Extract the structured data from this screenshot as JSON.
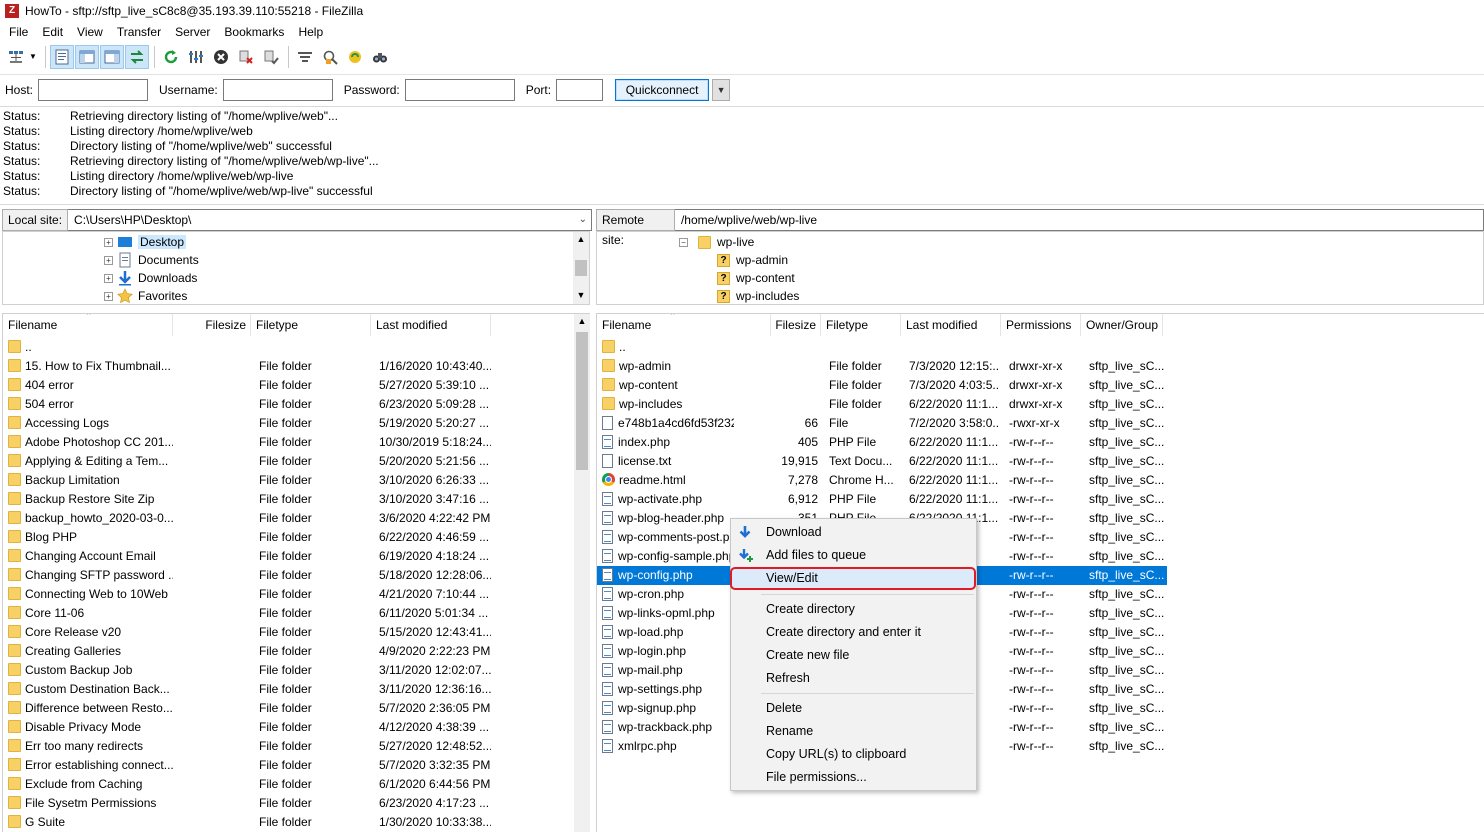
{
  "window": {
    "title": "HowTo - sftp://sftp_live_sC8c8@35.193.39.110:55218 - FileZilla",
    "app_icon": "filezilla-icon"
  },
  "menu": [
    "File",
    "Edit",
    "View",
    "Transfer",
    "Server",
    "Bookmarks",
    "Help"
  ],
  "toolbar": {
    "icons": [
      "site-manager-icon",
      "toggle-message-log-icon",
      "toggle-local-tree-icon",
      "toggle-remote-tree-icon",
      "toggle-transfer-queue-icon",
      "refresh-icon",
      "process-queue-icon",
      "cancel-icon",
      "disconnect-icon",
      "reconnect-icon",
      "directory-filter-icon",
      "compare-icon",
      "sync-browse-icon",
      "search-icon"
    ]
  },
  "quickconnect": {
    "host_label": "Host:",
    "host_value": "",
    "username_label": "Username:",
    "username_value": "",
    "password_label": "Password:",
    "password_value": "",
    "port_label": "Port:",
    "port_value": "",
    "button_label": "Quickconnect"
  },
  "log": [
    {
      "label": "Status:",
      "text": "Retrieving directory listing of \"/home/wplive/web\"..."
    },
    {
      "label": "Status:",
      "text": "Listing directory /home/wplive/web"
    },
    {
      "label": "Status:",
      "text": "Directory listing of \"/home/wplive/web\" successful"
    },
    {
      "label": "Status:",
      "text": "Retrieving directory listing of \"/home/wplive/web/wp-live\"..."
    },
    {
      "label": "Status:",
      "text": "Listing directory /home/wplive/web/wp-live"
    },
    {
      "label": "Status:",
      "text": "Directory listing of \"/home/wplive/web/wp-live\" successful"
    }
  ],
  "local": {
    "site_label": "Local site:",
    "path": "C:\\Users\\HP\\Desktop\\",
    "tree": [
      "Desktop",
      "Documents",
      "Downloads",
      "Favorites"
    ],
    "headers": [
      "Filename",
      "Filesize",
      "Filetype",
      "Last modified"
    ],
    "rows": [
      {
        "name": "..",
        "type": "",
        "modified": ""
      },
      {
        "name": "15. How to Fix Thumbnail...",
        "type": "File folder",
        "modified": "1/16/2020 10:43:40..."
      },
      {
        "name": "404 error",
        "type": "File folder",
        "modified": "5/27/2020 5:39:10 ..."
      },
      {
        "name": "504 error",
        "type": "File folder",
        "modified": "6/23/2020 5:09:28 ..."
      },
      {
        "name": "Accessing Logs",
        "type": "File folder",
        "modified": "5/19/2020 5:20:27 ..."
      },
      {
        "name": "Adobe Photoshop CC 201...",
        "type": "File folder",
        "modified": "10/30/2019 5:18:24..."
      },
      {
        "name": "Applying & Editing a Tem...",
        "type": "File folder",
        "modified": "5/20/2020 5:21:56 ..."
      },
      {
        "name": "Backup Limitation",
        "type": "File folder",
        "modified": "3/10/2020 6:26:33 ..."
      },
      {
        "name": "Backup Restore Site Zip",
        "type": "File folder",
        "modified": "3/10/2020 3:47:16 ..."
      },
      {
        "name": "backup_howto_2020-03-0...",
        "type": "File folder",
        "modified": "3/6/2020 4:22:42 PM"
      },
      {
        "name": "Blog PHP",
        "type": "File folder",
        "modified": "6/22/2020 4:46:59 ..."
      },
      {
        "name": "Changing Account Email",
        "type": "File folder",
        "modified": "6/19/2020 4:18:24 ..."
      },
      {
        "name": "Changing SFTP password ...",
        "type": "File folder",
        "modified": "5/18/2020 12:28:06..."
      },
      {
        "name": "Connecting Web to 10Web",
        "type": "File folder",
        "modified": "4/21/2020 7:10:44 ..."
      },
      {
        "name": "Core 11-06",
        "type": "File folder",
        "modified": "6/11/2020 5:01:34 ..."
      },
      {
        "name": "Core Release v20",
        "type": "File folder",
        "modified": "5/15/2020 12:43:41..."
      },
      {
        "name": "Creating Galleries",
        "type": "File folder",
        "modified": "4/9/2020 2:22:23 PM"
      },
      {
        "name": "Custom Backup Job",
        "type": "File folder",
        "modified": "3/11/2020 12:02:07..."
      },
      {
        "name": "Custom Destination Back...",
        "type": "File folder",
        "modified": "3/11/2020 12:36:16..."
      },
      {
        "name": "Difference between Resto...",
        "type": "File folder",
        "modified": "5/7/2020 2:36:05 PM"
      },
      {
        "name": "Disable Privacy Mode",
        "type": "File folder",
        "modified": "4/12/2020 4:38:39 ..."
      },
      {
        "name": "Err too many redirects",
        "type": "File folder",
        "modified": "5/27/2020 12:48:52..."
      },
      {
        "name": "Error establishing connect...",
        "type": "File folder",
        "modified": "5/7/2020 3:32:35 PM"
      },
      {
        "name": "Exclude from Caching",
        "type": "File folder",
        "modified": "6/1/2020 6:44:56 PM"
      },
      {
        "name": "File Sysetm Permissions",
        "type": "File folder",
        "modified": "6/23/2020 4:17:23 ..."
      },
      {
        "name": "G Suite",
        "type": "File folder",
        "modified": "1/30/2020 10:33:38..."
      }
    ]
  },
  "remote": {
    "site_label": "Remote site:",
    "path": "/home/wplive/web/wp-live",
    "tree": [
      "wp-live",
      "wp-admin",
      "wp-content",
      "wp-includes"
    ],
    "unknown_marker": "?",
    "headers": [
      "Filename",
      "Filesize",
      "Filetype",
      "Last modified",
      "Permissions",
      "Owner/Group"
    ],
    "rows": [
      {
        "name": "..",
        "kind": "folder",
        "size": "",
        "type": "",
        "modified": "",
        "perm": "",
        "owner": ""
      },
      {
        "name": "wp-admin",
        "kind": "folder",
        "size": "",
        "type": "File folder",
        "modified": "7/3/2020 12:15:...",
        "perm": "drwxr-xr-x",
        "owner": "sftp_live_sC..."
      },
      {
        "name": "wp-content",
        "kind": "folder",
        "size": "",
        "type": "File folder",
        "modified": "7/3/2020 4:03:5...",
        "perm": "drwxr-xr-x",
        "owner": "sftp_live_sC..."
      },
      {
        "name": "wp-includes",
        "kind": "folder",
        "size": "",
        "type": "File folder",
        "modified": "6/22/2020 11:1...",
        "perm": "drwxr-xr-x",
        "owner": "sftp_live_sC..."
      },
      {
        "name": "e748b1a4cd6fd53f232...",
        "kind": "file",
        "size": "66",
        "type": "File",
        "modified": "7/2/2020 3:58:0...",
        "perm": "-rwxr-xr-x",
        "owner": "sftp_live_sC..."
      },
      {
        "name": "index.php",
        "kind": "php",
        "size": "405",
        "type": "PHP File",
        "modified": "6/22/2020 11:1...",
        "perm": "-rw-r--r--",
        "owner": "sftp_live_sC..."
      },
      {
        "name": "license.txt",
        "kind": "file",
        "size": "19,915",
        "type": "Text Docu...",
        "modified": "6/22/2020 11:1...",
        "perm": "-rw-r--r--",
        "owner": "sftp_live_sC..."
      },
      {
        "name": "readme.html",
        "kind": "chrome",
        "size": "7,278",
        "type": "Chrome H...",
        "modified": "6/22/2020 11:1...",
        "perm": "-rw-r--r--",
        "owner": "sftp_live_sC..."
      },
      {
        "name": "wp-activate.php",
        "kind": "php",
        "size": "6,912",
        "type": "PHP File",
        "modified": "6/22/2020 11:1...",
        "perm": "-rw-r--r--",
        "owner": "sftp_live_sC..."
      },
      {
        "name": "wp-blog-header.php",
        "kind": "php",
        "size": "351",
        "type": "PHP File",
        "modified": "6/22/2020 11:1...",
        "perm": "-rw-r--r--",
        "owner": "sftp_live_sC..."
      },
      {
        "name": "wp-comments-post.php",
        "kind": "php",
        "size": "",
        "type": "",
        "modified": "",
        "perm": "-rw-r--r--",
        "owner": "sftp_live_sC..."
      },
      {
        "name": "wp-config-sample.php",
        "kind": "php",
        "size": "",
        "type": "",
        "modified": "",
        "perm": "-rw-r--r--",
        "owner": "sftp_live_sC..."
      },
      {
        "name": "wp-config.php",
        "kind": "php",
        "size": "",
        "type": "",
        "modified": "8:...",
        "perm": "-rw-r--r--",
        "owner": "sftp_live_sC...",
        "selected": true
      },
      {
        "name": "wp-cron.php",
        "kind": "php",
        "size": "",
        "type": "",
        "modified": "",
        "perm": "-rw-r--r--",
        "owner": "sftp_live_sC..."
      },
      {
        "name": "wp-links-opml.php",
        "kind": "php",
        "size": "",
        "type": "",
        "modified": "",
        "perm": "-rw-r--r--",
        "owner": "sftp_live_sC..."
      },
      {
        "name": "wp-load.php",
        "kind": "php",
        "size": "",
        "type": "",
        "modified": "",
        "perm": "-rw-r--r--",
        "owner": "sftp_live_sC..."
      },
      {
        "name": "wp-login.php",
        "kind": "php",
        "size": "",
        "type": "",
        "modified": "",
        "perm": "-rw-r--r--",
        "owner": "sftp_live_sC..."
      },
      {
        "name": "wp-mail.php",
        "kind": "php",
        "size": "",
        "type": "",
        "modified": "",
        "perm": "-rw-r--r--",
        "owner": "sftp_live_sC..."
      },
      {
        "name": "wp-settings.php",
        "kind": "php",
        "size": "",
        "type": "",
        "modified": "",
        "perm": "-rw-r--r--",
        "owner": "sftp_live_sC..."
      },
      {
        "name": "wp-signup.php",
        "kind": "php",
        "size": "",
        "type": "",
        "modified": "",
        "perm": "-rw-r--r--",
        "owner": "sftp_live_sC..."
      },
      {
        "name": "wp-trackback.php",
        "kind": "php",
        "size": "",
        "type": "",
        "modified": "",
        "perm": "-rw-r--r--",
        "owner": "sftp_live_sC..."
      },
      {
        "name": "xmlrpc.php",
        "kind": "php",
        "size": "",
        "type": "",
        "modified": "",
        "perm": "-rw-r--r--",
        "owner": "sftp_live_sC..."
      }
    ]
  },
  "context_menu": {
    "items": [
      "Download",
      "Add files to queue",
      "View/Edit",
      "Create directory",
      "Create directory and enter it",
      "Create new file",
      "Refresh",
      "Delete",
      "Rename",
      "Copy URL(s) to clipboard",
      "File permissions..."
    ],
    "highlighted": "View/Edit",
    "highlight_color": "#e01b24"
  },
  "colors": {
    "selection": "#0078d7",
    "folder": "#f7d165",
    "accent": "#0078d7"
  }
}
